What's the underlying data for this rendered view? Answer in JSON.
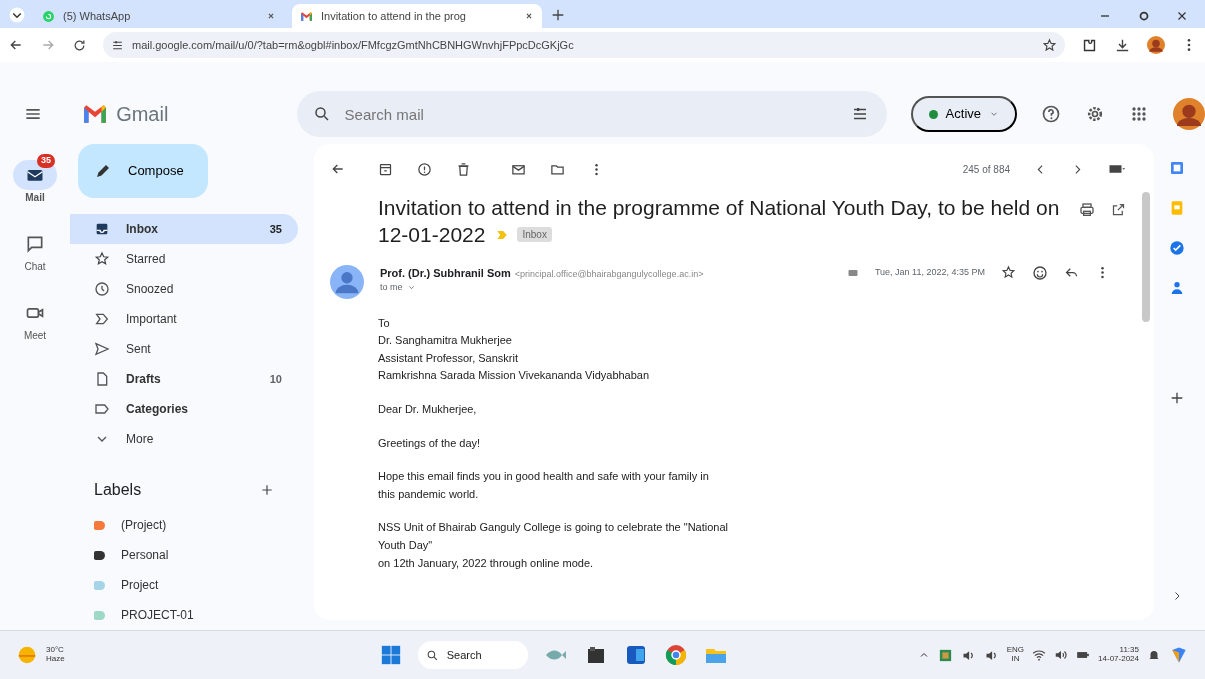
{
  "browser_tabs": [
    {
      "title": "(5) WhatsApp",
      "selected": false
    },
    {
      "title": "Invitation to attend in the prog",
      "selected": true
    }
  ],
  "address_bar": {
    "url": "mail.google.com/mail/u/0/?tab=rm&ogbl#inbox/FMfcgzGmtNhCBNHGWnvhjFPpcDcGKjGc"
  },
  "header": {
    "app_name": "Gmail",
    "search": {
      "placeholder": "Search mail"
    },
    "status": "Active"
  },
  "rail": [
    {
      "label": "Mail",
      "badge": "35",
      "selected": true
    },
    {
      "label": "Chat",
      "selected": false
    },
    {
      "label": "Meet",
      "selected": false
    }
  ],
  "compose": "Compose",
  "folders": [
    {
      "label": "Inbox",
      "count": "35",
      "selected": true,
      "unread": true
    },
    {
      "label": "Starred",
      "selected": false,
      "unread": false
    },
    {
      "label": "Snoozed",
      "selected": false,
      "unread": false
    },
    {
      "label": "Important",
      "selected": false,
      "unread": false
    },
    {
      "label": "Sent",
      "selected": false,
      "unread": false
    },
    {
      "label": "Drafts",
      "count": "10",
      "selected": false,
      "unread": true
    },
    {
      "label": "Categories",
      "selected": false,
      "unread": true
    },
    {
      "label": "More",
      "selected": false,
      "unread": false
    }
  ],
  "labels": {
    "title": "Labels",
    "items": [
      {
        "name": "(Project)",
        "color": "#f4793b"
      },
      {
        "name": "Personal",
        "color": "#333333"
      },
      {
        "name": "Project",
        "color": "#a6d5e8"
      },
      {
        "name": "PROJECT-01",
        "color": "#9ed8c6"
      }
    ]
  },
  "message": {
    "pager": "245 of 884",
    "subject": [
      "Invitation to attend in the programme of National Youth Day, to be held on",
      "12-01-2022"
    ],
    "important": true,
    "tag": "Inbox",
    "sender": "Prof. (Dr.) Subhranil Som",
    "email": "<principal.office@bhairabgangulycollege.ac.in>",
    "recipient": "to me",
    "date": "Tue, Jan 11, 2022, 4:35 PM",
    "body": [
      [
        "To",
        "Dr. Sanghamitra Mukherjee",
        "Assistant Professor, Sanskrit",
        "Ramkrishna Sarada Mission Vivekananda Vidyabhaban"
      ],
      [
        "Dear Dr. Mukherjee,"
      ],
      [
        "Greetings of the day!"
      ],
      [
        "Hope this email finds you in good health and safe with your family in",
        "this pandemic world."
      ],
      [
        "NSS Unit of Bhairab Ganguly College is going to celebrate the \"National",
        "Youth Day\"",
        "on 12th January, 2022 through online mode."
      ]
    ]
  },
  "taskbar": {
    "temperature": "30°C",
    "weather": "Haze",
    "search": "Search",
    "language": "ENG",
    "region": "IN",
    "time": "11:35",
    "date": "14-07-2024"
  }
}
